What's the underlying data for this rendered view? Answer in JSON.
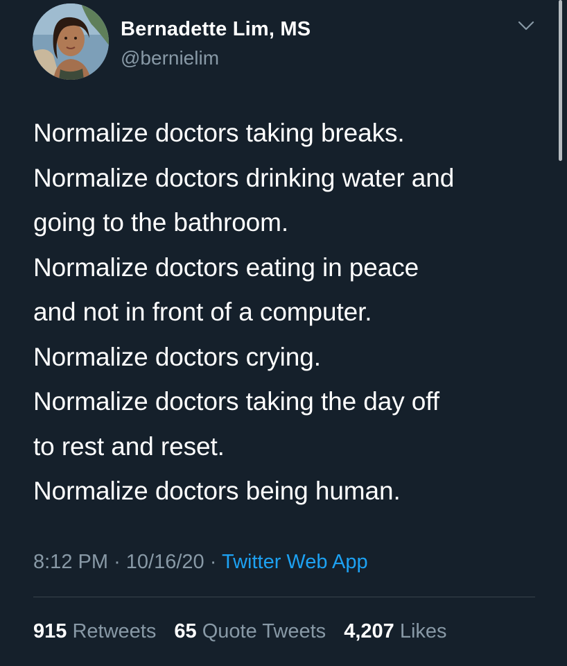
{
  "author": {
    "display_name": "Bernadette Lim, MS",
    "handle": "@bernielim",
    "avatar_icon": "profile-photo"
  },
  "tweet": {
    "lines": [
      "Normalize doctors taking breaks.",
      "Normalize doctors drinking water and",
      "going to the bathroom.",
      "Normalize doctors eating in peace",
      "and not in front of a computer.",
      "Normalize doctors crying.",
      "Normalize doctors taking the day off",
      "to rest and reset.",
      "Normalize doctors being human."
    ]
  },
  "meta": {
    "time": "8:12 PM",
    "separator": "·",
    "date": "10/16/20",
    "source": "Twitter Web App"
  },
  "stats": {
    "retweets_count": "915",
    "retweets_label": "Retweets",
    "quote_count": "65",
    "quote_label": "Quote Tweets",
    "likes_count": "4,207",
    "likes_label": "Likes"
  },
  "colors": {
    "background": "#15202b",
    "primary_text": "#ffffff",
    "secondary_text": "#8899a6",
    "link": "#1da1f2",
    "divider": "#38444d"
  }
}
